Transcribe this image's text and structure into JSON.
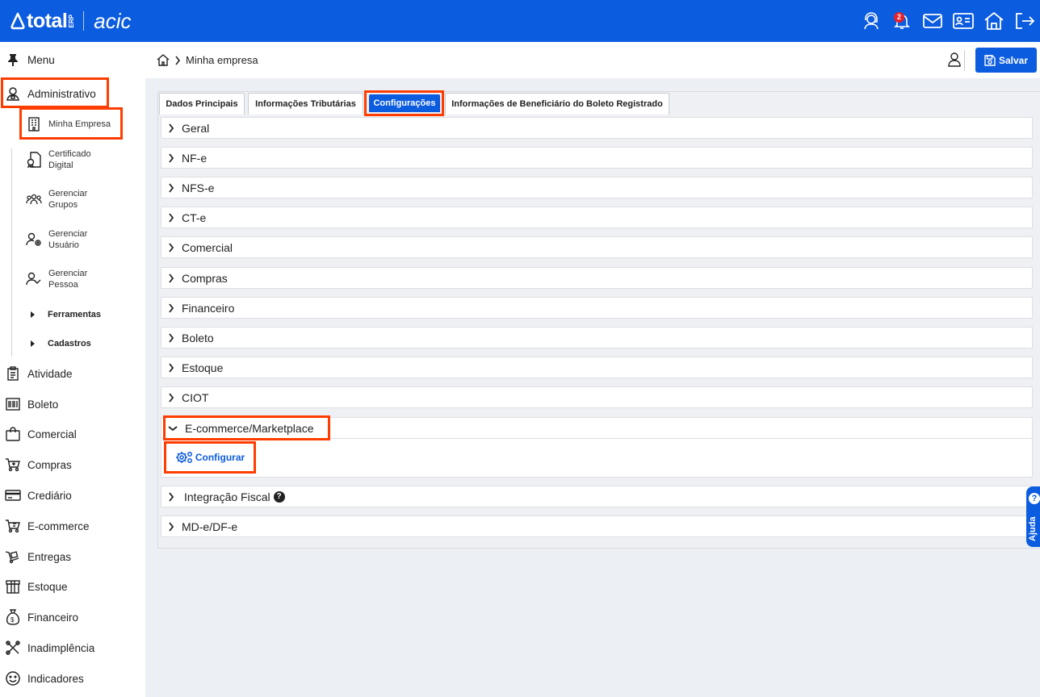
{
  "header": {
    "brand_total": "total",
    "brand_erp": "ERP",
    "brand_acic": "acic",
    "notification_count": "2",
    "accent_color": "#0c5ce0",
    "icons": [
      "support-agent-icon",
      "bell-icon",
      "mail-icon",
      "id-card-icon",
      "home-icon",
      "logout-icon"
    ]
  },
  "breadcrumb": {
    "page": "Minha empresa"
  },
  "toolbar": {
    "save_label": "Salvar"
  },
  "sidebar": {
    "menu_label": "Menu",
    "administrativo": "Administrativo",
    "sub_items": [
      {
        "label": "Minha Empresa"
      },
      {
        "line1": "Certificado",
        "line2": "Digital"
      },
      {
        "line1": "Gerenciar",
        "line2": "Grupos"
      },
      {
        "line1": "Gerenciar",
        "line2": "Usuário"
      },
      {
        "line1": "Gerenciar",
        "line2": "Pessoa"
      }
    ],
    "groups": [
      "Ferramentas",
      "Cadastros"
    ],
    "items": [
      "Atividade",
      "Boleto",
      "Comercial",
      "Compras",
      "Crediário",
      "E-commerce",
      "Entregas",
      "Estoque",
      "Financeiro",
      "Inadimplência",
      "Indicadores"
    ]
  },
  "tabs": [
    "Dados Principais",
    "Informações Tributárias",
    "Configurações",
    "Informações de Beneficiário do Boleto Registrado"
  ],
  "active_tab": "Configurações",
  "sections": [
    "Geral",
    "NF-e",
    "NFS-e",
    "CT-e",
    "Comercial",
    "Compras",
    "Financeiro",
    "Boleto",
    "Estoque",
    "CIOT",
    "E-commerce/Marketplace",
    "Integração Fiscal",
    "MD-e/DF-e"
  ],
  "expanded_section": {
    "configure_label": "Configurar"
  },
  "help_tab": {
    "label": "Ajuda",
    "symbol": "?"
  },
  "help_symbol": "?",
  "highlight_color": "#ff3d00"
}
